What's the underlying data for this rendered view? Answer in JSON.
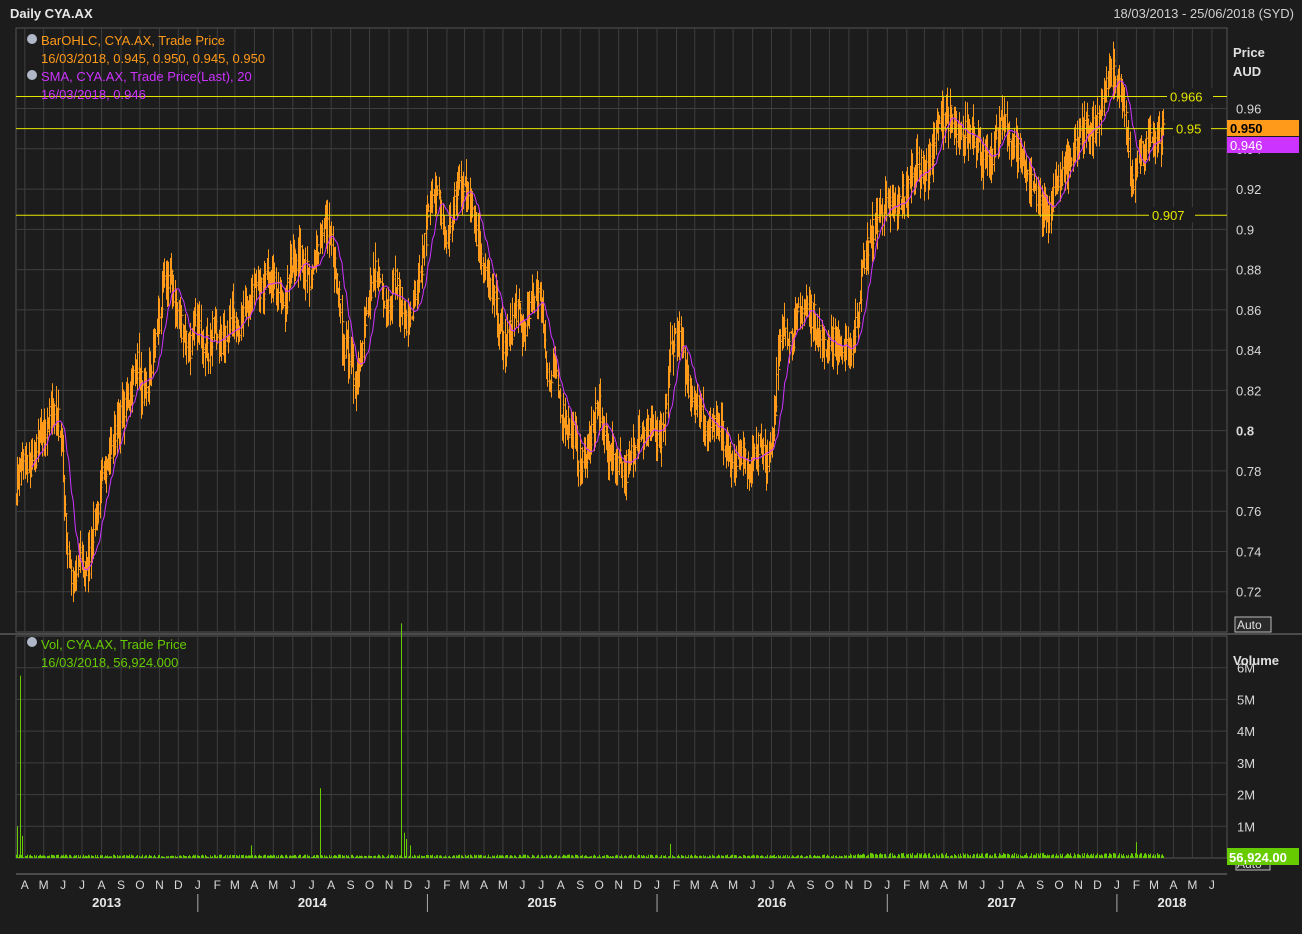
{
  "header": {
    "title": "Daily CYA.AX",
    "date_range": "18/03/2013 - 25/06/2018 (SYD)"
  },
  "price_panel": {
    "ohlc_legend": "BarOHLC, CYA.AX, Trade Price",
    "ohlc_values": "16/03/2018, 0.945, 0.950, 0.945, 0.950",
    "sma_legend": "SMA, CYA.AX, Trade Price(Last),  20",
    "sma_values": "16/03/2018, 0.946",
    "axis_title": "Price",
    "axis_unit": "AUD",
    "last_price_badge": "0.950",
    "sma_badge": "0.946",
    "auto_button": "Auto"
  },
  "volume_panel": {
    "legend": "Vol, CYA.AX, Trade Price",
    "values": "16/03/2018, 56,924.000",
    "axis_title": "Volume",
    "last_volume_badge": "56,924.00",
    "auto_button": "Auto"
  },
  "colors": {
    "background": "#1c1c1c",
    "grid": "#3e3e3e",
    "ohlc": "#ff9a1a",
    "sma": "#cc33ff",
    "volume": "#66cc00",
    "hline": "#e5e500",
    "axis_text": "#d8d8d8"
  },
  "chart_data": [
    {
      "type": "bar",
      "subtype": "ohlc",
      "x_range": [
        "2013-03-18",
        "2018-06-25"
      ],
      "ylim": [
        0.7,
        1.0
      ],
      "y_ticks": [
        "0.72",
        "0.74",
        "0.76",
        "0.78",
        "0.8",
        "0.82",
        "0.84",
        "0.86",
        "0.88",
        "0.9",
        "0.92",
        "0.94",
        "0.96"
      ],
      "bold_ticks": [
        "0.8"
      ],
      "grid": true,
      "legend_position": "top-left",
      "horizontal_lines": [
        {
          "value": 0.966,
          "label": "0.966"
        },
        {
          "value": 0.95,
          "label": "0.95"
        },
        {
          "value": 0.907,
          "label": "0.907"
        }
      ],
      "series": [
        {
          "name": "BarOHLC, CYA.AX, Trade Price",
          "color": "#ff9a1a",
          "closes_weekly": [
            0.772,
            0.785,
            0.782,
            0.788,
            0.796,
            0.804,
            0.812,
            0.8,
            0.742,
            0.72,
            0.738,
            0.728,
            0.752,
            0.765,
            0.784,
            0.793,
            0.804,
            0.811,
            0.822,
            0.835,
            0.812,
            0.83,
            0.85,
            0.87,
            0.878,
            0.861,
            0.852,
            0.84,
            0.851,
            0.848,
            0.839,
            0.852,
            0.842,
            0.852,
            0.858,
            0.85,
            0.861,
            0.87,
            0.866,
            0.875,
            0.873,
            0.868,
            0.862,
            0.884,
            0.887,
            0.883,
            0.872,
            0.892,
            0.903,
            0.897,
            0.872,
            0.843,
            0.838,
            0.822,
            0.848,
            0.861,
            0.88,
            0.872,
            0.862,
            0.876,
            0.862,
            0.852,
            0.862,
            0.872,
            0.902,
            0.922,
            0.912,
            0.893,
            0.907,
            0.924,
            0.92,
            0.917,
            0.896,
            0.88,
            0.871,
            0.858,
            0.842,
            0.848,
            0.862,
            0.85,
            0.858,
            0.872,
            0.862,
            0.822,
            0.828,
            0.81,
            0.802,
            0.798,
            0.782,
            0.79,
            0.802,
            0.812,
            0.792,
            0.788,
            0.786,
            0.78,
            0.788,
            0.802,
            0.797,
            0.806,
            0.791,
            0.8,
            0.84,
            0.85,
            0.836,
            0.821,
            0.814,
            0.81,
            0.798,
            0.807,
            0.802,
            0.786,
            0.786,
            0.79,
            0.781,
            0.786,
            0.792,
            0.786,
            0.8,
            0.84,
            0.853,
            0.845,
            0.858,
            0.862,
            0.858,
            0.852,
            0.84,
            0.846,
            0.843,
            0.838,
            0.84,
            0.852,
            0.882,
            0.896,
            0.902,
            0.912,
            0.911,
            0.907,
            0.916,
            0.92,
            0.932,
            0.93,
            0.927,
            0.94,
            0.955,
            0.958,
            0.952,
            0.942,
            0.947,
            0.951,
            0.942,
            0.932,
            0.931,
            0.951,
            0.952,
            0.946,
            0.94,
            0.935,
            0.922,
            0.92,
            0.91,
            0.908,
            0.917,
            0.927,
            0.932,
            0.938,
            0.947,
            0.952,
            0.95,
            0.96,
            0.97,
            0.978,
            0.972,
            0.952,
            0.92,
            0.935,
            0.94,
            0.95,
            0.945,
            0.95
          ]
        },
        {
          "name": "SMA, CYA.AX, Trade Price(Last),  20",
          "color": "#cc33ff",
          "values_weekly": "20-period simple moving average of the trade price (computed from closes)"
        }
      ]
    },
    {
      "type": "bar",
      "x_range": [
        "2013-03-18",
        "2018-06-25"
      ],
      "y_ticks": [
        "1M",
        "2M",
        "3M",
        "4M",
        "5M",
        "6M"
      ],
      "ylim": [
        0,
        7000000
      ],
      "series": [
        {
          "name": "Vol, CYA.AX, Trade Price",
          "color": "#66cc00",
          "baseline_volume": 60000,
          "spikes": [
            {
              "date": "2013-03-20",
              "value": 1000000
            },
            {
              "date": "2013-03-25",
              "value": 5750000
            },
            {
              "date": "2013-03-28",
              "value": 700000
            },
            {
              "date": "2014-03-26",
              "value": 400000
            },
            {
              "date": "2014-07-14",
              "value": 2200000
            },
            {
              "date": "2014-11-20",
              "value": 7400000
            },
            {
              "date": "2014-11-24",
              "value": 800000
            },
            {
              "date": "2014-11-28",
              "value": 600000
            },
            {
              "date": "2014-12-05",
              "value": 400000
            },
            {
              "date": "2016-01-22",
              "value": 450000
            },
            {
              "date": "2016-11-20",
              "value": 450000
            },
            {
              "date": "2017-04-08",
              "value": 500000
            },
            {
              "date": "2018-02-01",
              "value": 500000
            },
            {
              "date": "2018-03-16",
              "value": 56924
            }
          ]
        }
      ]
    }
  ],
  "x_axis": {
    "month_letters": [
      "A",
      "M",
      "J",
      "J",
      "A",
      "S",
      "O",
      "N",
      "D",
      "J",
      "F",
      "M",
      "A",
      "M",
      "J",
      "J",
      "A",
      "S",
      "O",
      "N",
      "D",
      "J",
      "F",
      "M",
      "A",
      "M",
      "J",
      "J",
      "A",
      "S",
      "O",
      "N",
      "D",
      "J",
      "F",
      "M",
      "A",
      "M",
      "J",
      "J",
      "A",
      "S",
      "O",
      "N",
      "D",
      "J",
      "F",
      "M",
      "A",
      "M",
      "J",
      "J",
      "A",
      "S",
      "O",
      "N",
      "D",
      "J",
      "F",
      "M",
      "A",
      "M",
      "J"
    ],
    "year_labels": [
      "2013",
      "2014",
      "2015",
      "2016",
      "2017",
      "2018"
    ]
  }
}
